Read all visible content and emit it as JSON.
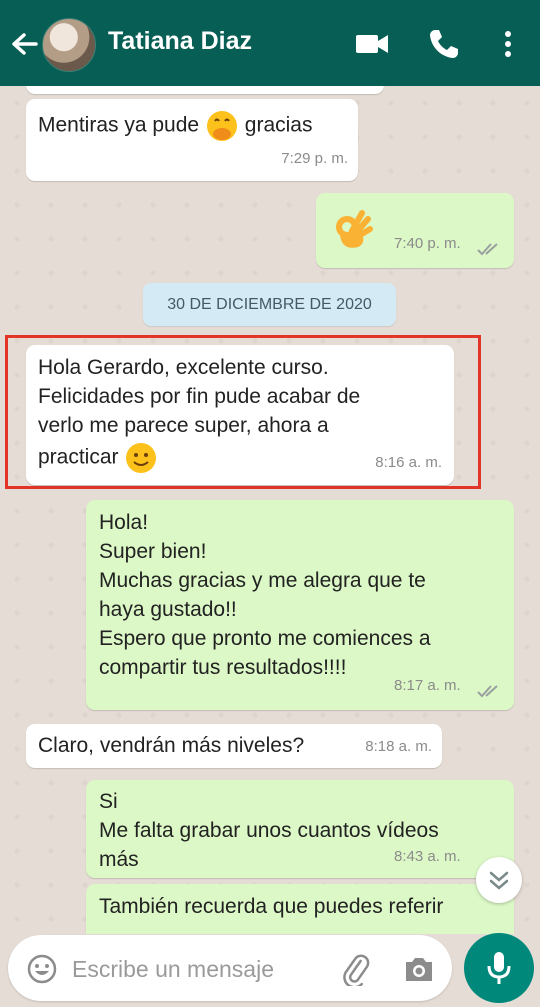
{
  "header": {
    "contact_name": "Tatiana Diaz",
    "icons": [
      "back-arrow-icon",
      "video-call-icon",
      "phone-icon",
      "more-vert-icon"
    ],
    "bar_color": "#075e54"
  },
  "messages": [
    {
      "text": "Mentiras ya pude",
      "text_after": "gracias",
      "emoji": "hand-over-mouth-emoji",
      "time": "7:29 p. m."
    },
    {
      "emoji": "ok-hand-emoji",
      "time": "7:40 p. m."
    },
    {
      "text": "Hola Gerardo, excelente curso.\nFelicidades por fin pude acabar de\nverlo me parece super, ahora a",
      "text_last": "practicar",
      "emoji": "slightly-smiling-emoji",
      "time": "8:16 a. m."
    },
    {
      "text": "Hola!\nSuper bien!\nMuchas gracias y me alegra que te\nhaya gustado!!\nEspero que pronto me comiences a\ncompartir tus resultados!!!!",
      "time": "8:17 a. m."
    },
    {
      "text": "Claro, vendrán más niveles?",
      "time": "8:18 a. m."
    },
    {
      "text": "Si\nMe falta grabar unos cuantos vídeos\nmás",
      "time": "8:43 a. m."
    },
    {
      "text": "También recuerda que puedes referir"
    }
  ],
  "date_divider": "30 DE DICIEMBRE DE 2020",
  "composer": {
    "placeholder": "Escribe un mensaje",
    "icons": [
      "emoji-icon",
      "attach-icon",
      "camera-icon",
      "mic-icon"
    ]
  },
  "colors": {
    "incoming": "#ffffff",
    "outgoing": "#dcf8c6",
    "highlight": "#e3342a",
    "accent": "#00897b"
  }
}
